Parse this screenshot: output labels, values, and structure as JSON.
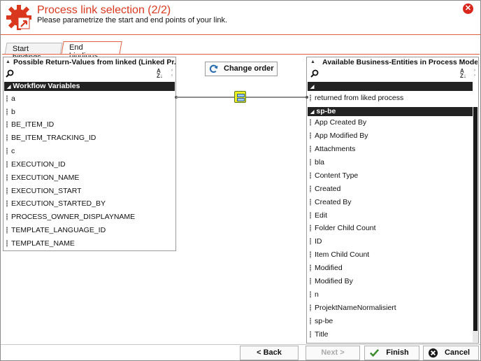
{
  "header": {
    "title": "Process link selection (2/2)",
    "subtitle": "Please parametrize the start and end points of your link.",
    "close_icon": "close-icon",
    "app_icon": "gear-arrow-icon"
  },
  "tabs": [
    {
      "label": "Start bindings",
      "active": false
    },
    {
      "label": "End bindings",
      "active": true
    }
  ],
  "left_panel": {
    "title": "Possible Return-Values from linked (Linked Pr...",
    "group": "Workflow Variables",
    "items": [
      "a",
      "b",
      "BE_ITEM_ID",
      "BE_ITEM_TRACKING_ID",
      "c",
      "EXECUTION_ID",
      "EXECUTION_NAME",
      "EXECUTION_START",
      "EXECUTION_STARTED_BY",
      "PROCESS_OWNER_DISPLAYNAME",
      "TEMPLATE_LANGUAGE_ID",
      "TEMPLATE_NAME"
    ]
  },
  "center": {
    "change_order_label": "Change order"
  },
  "right_panel": {
    "title": "Available Business-Entities in Process Model",
    "group1_label": "",
    "group1_items": [
      "returned from liked process"
    ],
    "group2_label": "sp-be",
    "group2_items": [
      "App Created By",
      "App Modified By",
      "Attachments",
      "bla",
      "Content Type",
      "Created",
      "Created By",
      "Edit",
      "Folder Child Count",
      "ID",
      "Item Child Count",
      "Modified",
      "Modified By",
      "n",
      "ProjektNameNormalisiert",
      "sp-be",
      "Title"
    ]
  },
  "footer": {
    "back_label": "< Back",
    "next_label": "Next >",
    "finish_label": "Finish",
    "cancel_label": "Cancel"
  },
  "colors": {
    "accent": "#d9381e",
    "group_header": "#222222",
    "link_node": "#f0f020"
  }
}
